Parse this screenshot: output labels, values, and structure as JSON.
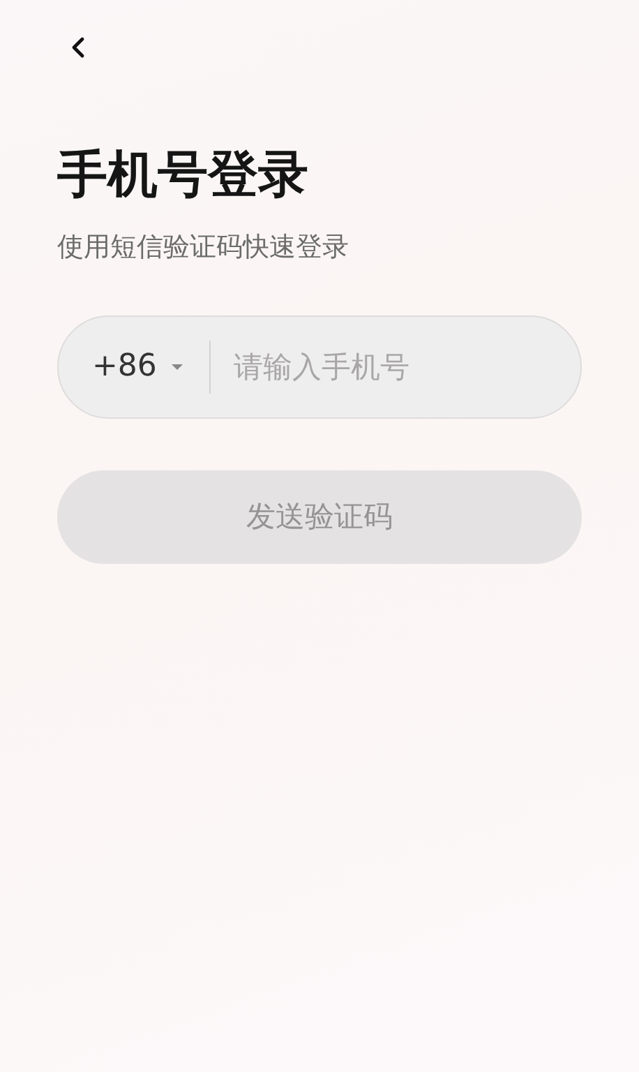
{
  "title": "手机号登录",
  "subtitle": "使用短信验证码快速登录",
  "phone_field": {
    "country_code": "+86",
    "placeholder": "请输入手机号"
  },
  "send_button": {
    "label": "发送验证码",
    "disabled": true
  }
}
